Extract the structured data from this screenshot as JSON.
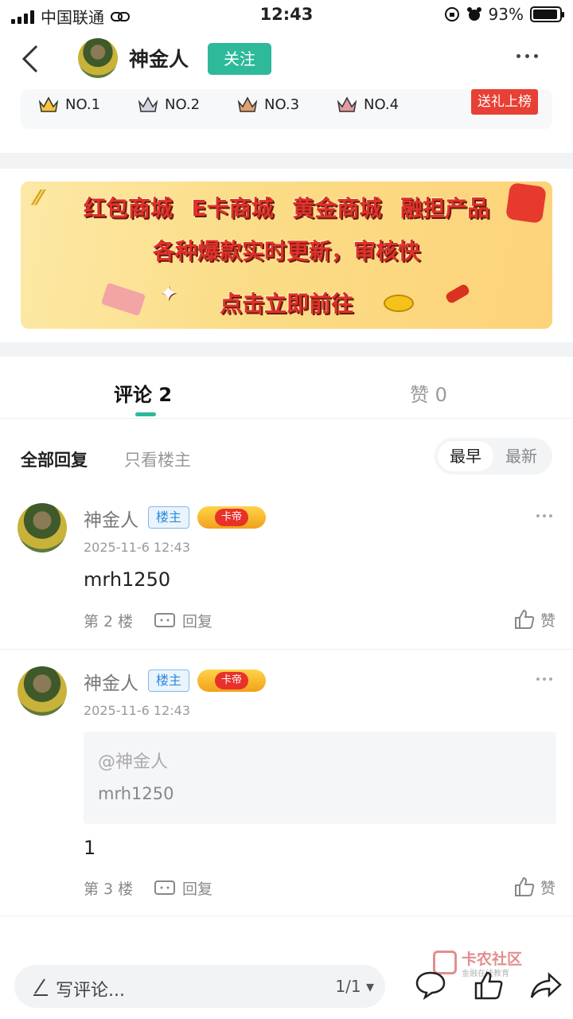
{
  "status_bar": {
    "carrier": "中国联通",
    "time": "12:43",
    "battery": "93%",
    "battery_level": 0.93
  },
  "header": {
    "username": "神金人",
    "follow_label": "关注"
  },
  "ranking": {
    "items": [
      "NO.1",
      "NO.2",
      "NO.3",
      "NO.4"
    ],
    "gift_label": "送礼上榜"
  },
  "banner": {
    "line1": "红包商城  E卡商城  黄金商城  融担产品",
    "line2": "各种爆款实时更新，审核快",
    "line3": "点击立即前往"
  },
  "tabs": {
    "comments": "评论 2",
    "likes": "赞 0"
  },
  "filter": {
    "all": "全部回复",
    "owner_only": "只看楼主",
    "sort_earliest": "最早",
    "sort_latest": "最新"
  },
  "comments": [
    {
      "name": "神金人",
      "owner_badge": "楼主",
      "level_badge": "卡帝",
      "time": "2025-11-6 12:43",
      "text": "mrh1250",
      "floor": "第 2 楼",
      "reply_label": "回复",
      "like_label": "赞"
    },
    {
      "name": "神金人",
      "owner_badge": "楼主",
      "level_badge": "卡帝",
      "time": "2025-11-6 12:43",
      "quote_name": "@神金人",
      "quote_text": "mrh1250",
      "text": "1",
      "floor": "第 3 楼",
      "reply_label": "回复",
      "like_label": "赞"
    }
  ],
  "bottom_bar": {
    "placeholder": "写评论...",
    "page": "1/1"
  },
  "watermark": {
    "title": "卡农社区",
    "subtitle": "金融在线教育"
  },
  "colors": {
    "accent": "#2db99a",
    "gift": "#e84034",
    "owner_badge": "#2d8ad8"
  }
}
